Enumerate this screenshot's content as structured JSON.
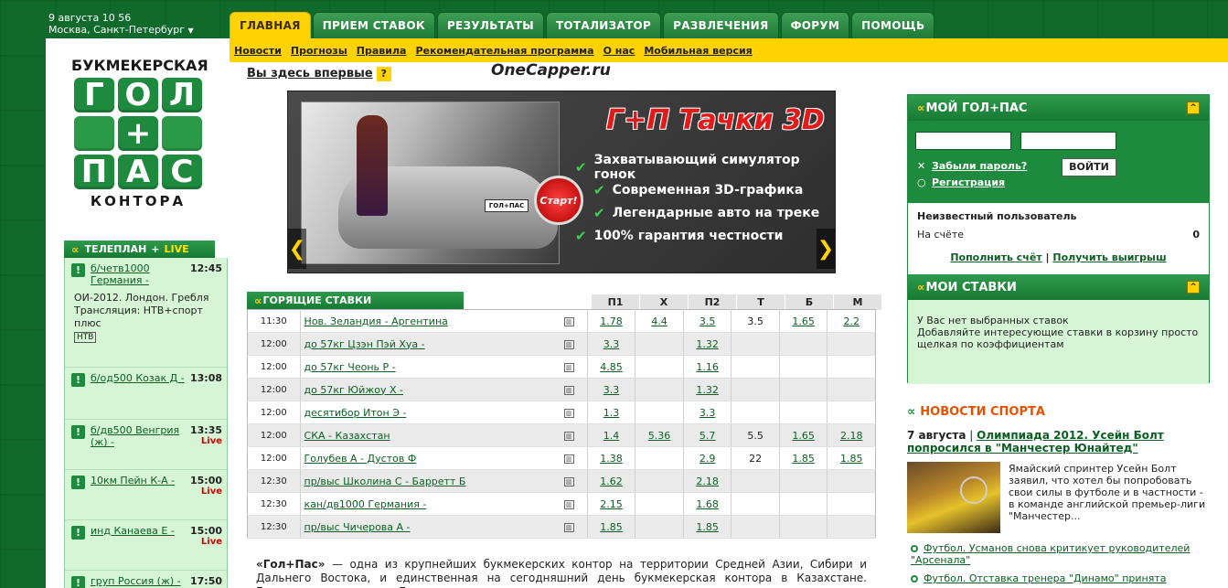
{
  "top": {
    "date": "9 августа 10 56",
    "city": "Москва, Санкт-Петербург"
  },
  "logo": {
    "top": "БУКМЕКЕРСКАЯ",
    "row1": [
      "Г",
      "О",
      "Л"
    ],
    "plus": "+",
    "row3": [
      "П",
      "А",
      "С"
    ],
    "bottom": "КОНТОРА"
  },
  "tabs": [
    "ГЛАВНАЯ",
    "ПРИЕМ СТАВОК",
    "РЕЗУЛЬТАТЫ",
    "ТОТАЛИЗАТОР",
    "РАЗВЛЕЧЕНИЯ",
    "ФОРУМ",
    "ПОМОЩЬ"
  ],
  "subnav": [
    "Новости",
    "Прогнозы",
    "Правила",
    "Рекомендательная программа",
    "О нас",
    "Мобильная версия"
  ],
  "first_time": {
    "label": "Вы здесь впервые",
    "help": "?"
  },
  "watermark": "OneCapper.ru",
  "banner": {
    "title": "Г+П Тачки 3D",
    "start": "Старт!",
    "plate": "ГОЛ+ПАС",
    "features": [
      "Захватывающий симулятор гонок",
      "Современная 3D-графика",
      "Легендарные авто на треке",
      "100% гарантия честности"
    ],
    "prev": "❮",
    "next": "❯"
  },
  "tvplan": {
    "title": "ТЕЛЕПЛАН",
    "plus": "+",
    "live_word": "LIVE",
    "items": [
      {
        "name": "б/четв1000 Германия -",
        "time": "12:45",
        "live": "",
        "desc": "ОИ-2012. Лондон. Гребля Трансляция: НТВ+спорт плюс",
        "tv": "НТВ"
      },
      {
        "name": "б/од500 Козак Д -",
        "time": "13:08",
        "live": ""
      },
      {
        "name": "б/дв500 Венгрия (ж) -",
        "time": "13:35",
        "live": "Live"
      },
      {
        "name": "10км Пейн К-А -",
        "time": "15:00",
        "live": "Live"
      },
      {
        "name": "инд Канаева Е -",
        "time": "15:00",
        "live": "Live"
      },
      {
        "name": "груп Россия (ж) -",
        "time": "17:50",
        "live": ""
      }
    ]
  },
  "hotbets": {
    "title": "ГОРЯЩИЕ СТАВКИ",
    "columns": [
      "П1",
      "Х",
      "П2",
      "Т",
      "Б",
      "М"
    ],
    "rows": [
      {
        "time": "11:30",
        "event": "Нов. Зеландия - Аргентина",
        "p1": "1.78",
        "x": "4.4",
        "p2": "3.5",
        "t": "3.5",
        "b": "1.65",
        "m": "2.2"
      },
      {
        "time": "12:00",
        "event": "до 57кг Цзэн Пэй Хуа -",
        "p1": "3.3",
        "x": "",
        "p2": "1.32",
        "t": "",
        "b": "",
        "m": ""
      },
      {
        "time": "12:00",
        "event": "до 57кг Чеонь Р -",
        "p1": "4.85",
        "x": "",
        "p2": "1.16",
        "t": "",
        "b": "",
        "m": ""
      },
      {
        "time": "12:00",
        "event": "до 57кг Юйжоу Х -",
        "p1": "3.3",
        "x": "",
        "p2": "1.32",
        "t": "",
        "b": "",
        "m": ""
      },
      {
        "time": "12:00",
        "event": "десятибор Итон Э -",
        "p1": "1.3",
        "x": "",
        "p2": "3.3",
        "t": "",
        "b": "",
        "m": ""
      },
      {
        "time": "12:00",
        "event": "СКА - Казахстан",
        "p1": "1.4",
        "x": "5.36",
        "p2": "5.7",
        "t": "5.5",
        "b": "1.65",
        "m": "2.18"
      },
      {
        "time": "12:00",
        "event": "Голубев А - Дустов Ф",
        "p1": "1.38",
        "x": "",
        "p2": "2.9",
        "t": "22",
        "b": "1.85",
        "m": "1.85"
      },
      {
        "time": "12:30",
        "event": "пр/выс Школина С - Барретт Б",
        "p1": "1.62",
        "x": "",
        "p2": "2.18",
        "t": "",
        "b": "",
        "m": ""
      },
      {
        "time": "12:30",
        "event": "кан/дв1000 Германия -",
        "p1": "2.15",
        "x": "",
        "p2": "1.68",
        "t": "",
        "b": "",
        "m": ""
      },
      {
        "time": "12:30",
        "event": "пр/выс Чичерова А -",
        "p1": "1.85",
        "x": "",
        "p2": "1.85",
        "t": "",
        "b": "",
        "m": ""
      }
    ]
  },
  "about": {
    "brand": "«Гол+Пас»",
    "text": " — одна из крупнейших букмекерских контор на территории Средней Азии, Сибири и Дальнего Востока, и единственная на сегодняшний день букмекерская контора в Казахстане. Букмекерская контора «Гол+пас» принимает ставки на"
  },
  "my": {
    "title": "МОЙ ГОЛ+ПАС",
    "collapse": "^",
    "login_value": "",
    "password_value": "",
    "forgot": "Забыли пароль?",
    "register": "Регистрация",
    "login_btn": "ВОЙТИ",
    "user": "Неизвестный пользователь",
    "balance_label": "На счёте",
    "balance": "0",
    "topup": "Пополнить счёт",
    "sep": "|",
    "withdraw": "Получить выигрыш"
  },
  "mybets": {
    "title": "МОИ СТАВКИ",
    "collapse": "^",
    "empty": "У Вас нет выбранных ставок",
    "hint": "Добавляйте интересующие ставки в корзину просто щелкая по коэффициентам"
  },
  "news": {
    "title": "НОВОСТИ СПОРТА",
    "main_date": "7 августа",
    "main_sep": " | ",
    "main_link": "Олимпиада 2012. Усейн Болт попросился в \"Манчестер Юнайтед\"",
    "main_text": "Ямайский спринтер Усейн Болт заявил, что хотел бы попробовать свои силы в футболе и в частности - в команде английской премьер-лиги \"Манчестер...",
    "items": [
      "Футбол. Усманов снова критикует руководителей \"Арсенала\"",
      "Футбол. Отставка тренера \"Динамо\" принята"
    ]
  }
}
